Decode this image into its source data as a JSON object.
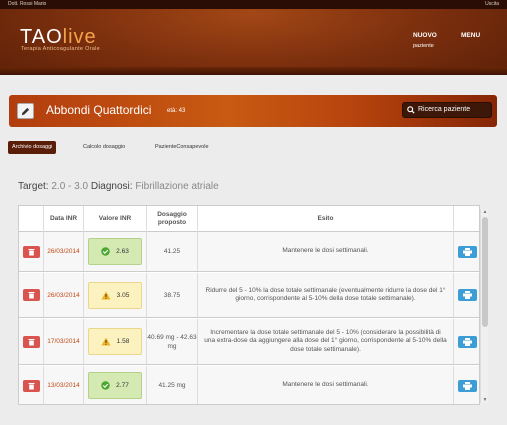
{
  "topbar": {
    "user": "Dott. Rossi Mario",
    "logout": "Uscita"
  },
  "brand": {
    "logo_main": "TAO",
    "logo_accent": "live",
    "subtitle": "Terapia Anticoagulante Orale",
    "accent_color": "#f4a24a"
  },
  "nav": {
    "nuovo": "NUOVO",
    "nuovo_sub": "paziente",
    "menu": "MENU"
  },
  "patient": {
    "name": "Abbondi Quattordici",
    "age": "età: 43",
    "search_label": "Ricerca paziente"
  },
  "tabs": [
    {
      "label": "Archivio dosaggi",
      "active": true
    },
    {
      "label": "Calcolo dosaggio",
      "active": false
    },
    {
      "label": "PazienteConsapevole",
      "active": false
    }
  ],
  "target": {
    "label": "Target:",
    "value": "2.0 - 3.0",
    "diagnosis_label": "Diagnosi:",
    "diagnosis": "Fibrillazione atriale"
  },
  "table": {
    "headers": {
      "date": "Data INR",
      "inr": "Valore INR",
      "dosage": "Dosaggio proposto",
      "result": "Esito"
    },
    "rows": [
      {
        "date": "26/03/2014",
        "inr": "2.63",
        "status": "ok",
        "dosage": "41.25",
        "result": "Mantenere le dosi settimanali."
      },
      {
        "date": "26/03/2014",
        "inr": "3.05",
        "status": "warn",
        "dosage": "38.75",
        "result": "Ridurre del 5 - 10% la dose totale settimanale (eventualmente ridurre la dose del 1° giorno, corrispondente al 5-10% della dose totale settimanale)."
      },
      {
        "date": "17/03/2014",
        "inr": "1.58",
        "status": "warn",
        "dosage": "40.69 mg - 42.63 mg",
        "result": "Incrementare la dose totale settimanale del 5 - 10% (considerare la possibilità di una extra-dose da aggiungere alla dose del 1° giorno, corrispondente al 5-10% della dose totale settimanale)."
      },
      {
        "date": "13/03/2014",
        "inr": "2.77",
        "status": "ok",
        "dosage": "41.25 mg",
        "result": "Mantenere le dosi settimanali."
      }
    ]
  },
  "colors": {
    "delete": "#d9534f",
    "print": "#3d9dd6",
    "ok_bg": "#d5e9b2",
    "warn_bg": "#fbf2bf",
    "date": "#c24a17"
  },
  "icons": {
    "delete": "trash-icon",
    "print": "print-icon",
    "ok": "check-circle-icon",
    "warn": "warning-icon",
    "edit": "pencil-icon",
    "search": "search-icon"
  }
}
